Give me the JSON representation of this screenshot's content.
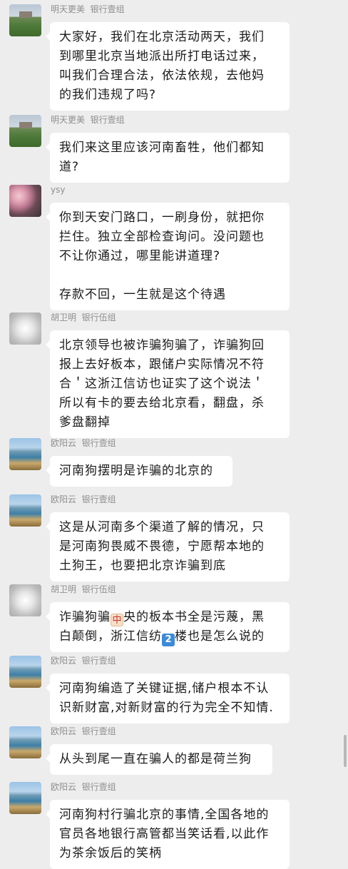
{
  "messages": [
    {
      "sender": "明天更美",
      "group": "银行壹组",
      "avatar": "field-avatar",
      "lines": [
        "大家好，我们在北京活动两天，我们",
        "到哪里北京当地派出所打电话过来，",
        "叫我们合理合法，依法依规，去他妈",
        "的我们违规了吗?"
      ]
    },
    {
      "sender": "明天更美",
      "group": "银行壹组",
      "avatar": "field-avatar",
      "lines": [
        "我们来这里应该河南畜牲，他们都知",
        "道?"
      ]
    },
    {
      "sender": "ysy",
      "group": "",
      "avatar": "blossom-avatar",
      "lines": [
        "你到天安门路口，一刷身份，就把你",
        "拦住。独立全部检查询问。没问题也",
        "不让你通过，哪里能讲道理?",
        "",
        "存款不回，一生就是这个待遇"
      ]
    },
    {
      "sender": "胡卫明",
      "group": "银行伍组",
      "avatar": "blur-avatar",
      "lines": [
        "北京领导也被诈骗狗骗了，诈骗狗回",
        "报上去好板本，跟储户实际情况不符",
        "合＇这浙江信访也证实了这个说法＇",
        "所以有卡的要去给北京看，翻盘，杀",
        "爹盘翻掉"
      ]
    },
    {
      "sender": "欧阳云",
      "group": "银行壹组",
      "avatar": "lake-avatar",
      "lines": [
        "河南狗摆明是诈骗的北京的"
      ]
    },
    {
      "sender": "欧阳云",
      "group": "银行壹组",
      "avatar": "lake-avatar",
      "lines": [
        "这是从河南多个渠道了解的情况，只",
        "是河南狗畏威不畏德，宁愿帮本地的",
        "土狗王，也要把北京诈骗到底"
      ]
    },
    {
      "sender": "胡卫明",
      "group": "银行伍组",
      "avatar": "blur-avatar",
      "line1_a": "诈骗狗骗",
      "emoji1": "中",
      "line1_b": "央的板本书全是污蔑，黑",
      "line2_a": "白颠倒，浙江信纺",
      "emoji2": "2",
      "line2_b": "楼也是怎么说的"
    },
    {
      "sender": "欧阳云",
      "group": "银行壹组",
      "avatar": "lake-avatar",
      "lines": [
        "河南狗编造了关键证据,储户根本不认",
        "识新财富,对新财富的行为完全不知情."
      ]
    },
    {
      "sender": "欧阳云",
      "group": "银行壹组",
      "avatar": "lake-avatar",
      "lines": [
        "从头到尾一直在骗人的都是荷兰狗"
      ]
    },
    {
      "sender": "欧阳云",
      "group": "银行壹组",
      "avatar": "lake-avatar",
      "lines": [
        "河南狗村行骗北京的事情,全国各地的",
        "官员各地银行高管都当笑话看,以此作",
        "为茶余饭后的笑柄"
      ]
    }
  ],
  "colors": {
    "background": "#ededed",
    "bubble": "#ffffff",
    "text": "#1a1a1a",
    "name": "#8f8f8f"
  }
}
